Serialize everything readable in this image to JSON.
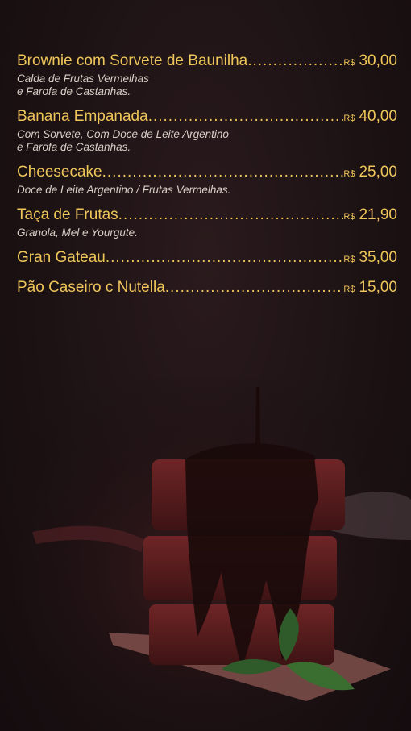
{
  "menu": {
    "currency": "R$",
    "items": [
      {
        "name": "Brownie com Sorvete de Baunilha",
        "price": "30,00",
        "description": "Calda de Frutas Vermelhas\ne Farofa de Castanhas."
      },
      {
        "name": "Banana Empanada",
        "price": "40,00",
        "description": "Com Sorvete, Com Doce de Leite Argentino\ne Farofa de Castanhas."
      },
      {
        "name": "Cheesecake",
        "price": "25,00",
        "description": "Doce de Leite Argentino / Frutas Vermelhas."
      },
      {
        "name": "Taça de Frutas",
        "price": "21,90",
        "description": "Granola, Mel e Yourgute."
      },
      {
        "name": "Gran Gateau",
        "price": "35,00",
        "description": ""
      },
      {
        "name": "Pão Caseiro c Nutella",
        "price": "15,00",
        "description": ""
      }
    ]
  },
  "colors": {
    "title": "#efc65a",
    "description": "#d9cfc6",
    "background": "#1c1214"
  }
}
